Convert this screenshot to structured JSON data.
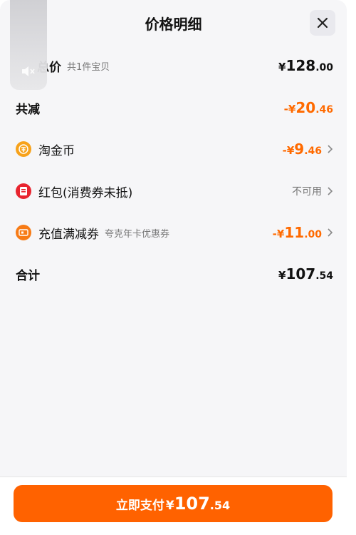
{
  "header": {
    "title": "价格明细"
  },
  "rows": {
    "total": {
      "label": "总价",
      "sub": "共1件宝贝",
      "currency": "¥",
      "int": "128",
      "dec": ".00"
    },
    "reduce": {
      "label": "共减",
      "sign": "-¥",
      "int": "20",
      "dec": ".46"
    },
    "coin": {
      "label": "淘金币",
      "sign": "-¥",
      "int": "9",
      "dec": ".46"
    },
    "redpacket": {
      "label": "红包(消费券未抵)",
      "status": "不可用"
    },
    "coupon": {
      "label": "充值满减券",
      "sub": "夸克年卡优惠券",
      "sign": "-¥",
      "int": "11",
      "dec": ".00"
    },
    "sum": {
      "label": "合计",
      "currency": "¥",
      "int": "107",
      "dec": ".54"
    }
  },
  "footer": {
    "button_label": "立即支付",
    "currency": "¥",
    "int": "107",
    "dec": ".54"
  },
  "colors": {
    "accent": "#ff6200",
    "discount": "#ff6a00"
  },
  "icons": {
    "coin": "coin-icon",
    "redpacket": "red-packet-icon",
    "coupon": "coupon-icon",
    "close": "close-icon",
    "speaker": "speaker-muted-icon",
    "chevron": "chevron-right-icon"
  }
}
